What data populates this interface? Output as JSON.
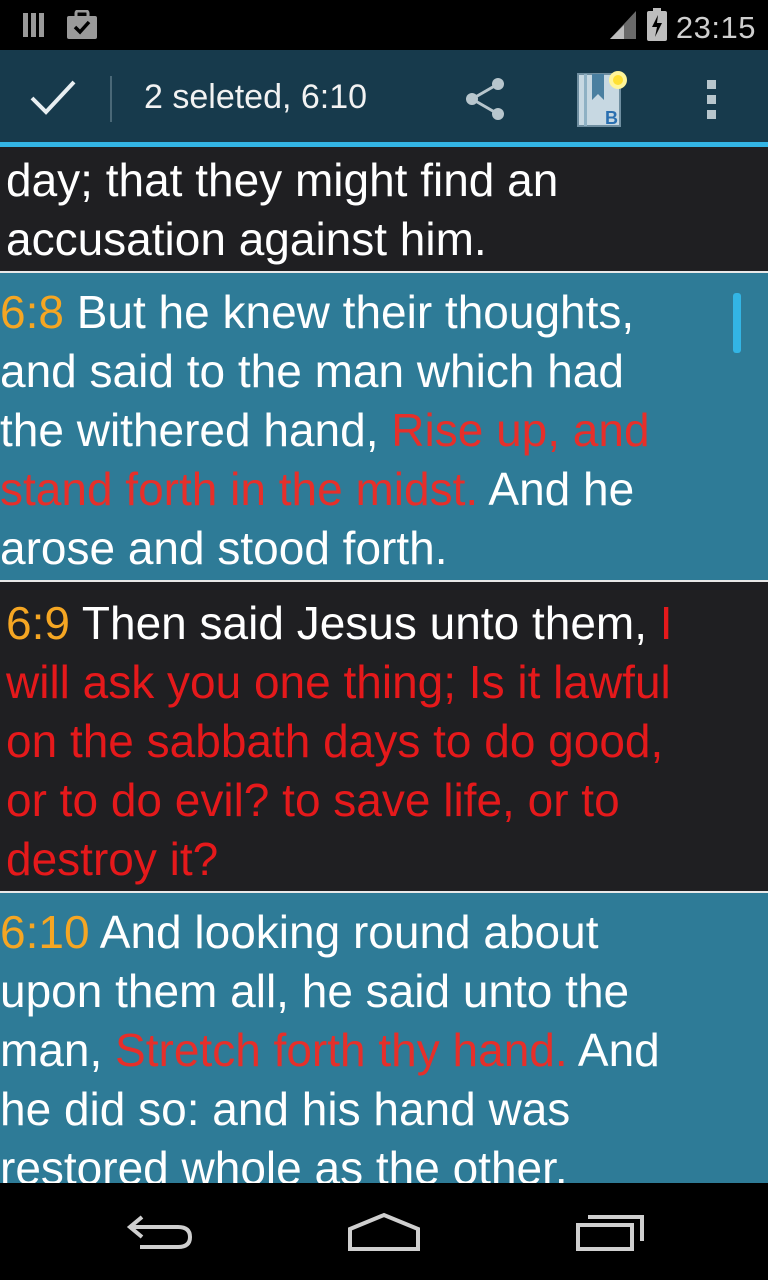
{
  "status_bar": {
    "time": "23:15",
    "icons": [
      "library-icon",
      "clipboard-check-icon",
      "signal-icon",
      "battery-icon"
    ]
  },
  "action_bar": {
    "done_icon": "check-icon",
    "title": "2 seleted, 6:10",
    "actions": [
      "share-icon",
      "bible-bookmark-icon",
      "overflow-menu-icon"
    ],
    "accent_color": "#33b5e5",
    "background_color": "#173a4c"
  },
  "verses": [
    {
      "ref": "",
      "selected": false,
      "lines": [
        [
          {
            "t": "day; that they might find an",
            "c": "w"
          }
        ],
        [
          {
            "t": "accusation against him.",
            "c": "w"
          }
        ]
      ]
    },
    {
      "ref": "6:8",
      "selected": true,
      "lines": [
        [
          {
            "t": "6:8",
            "c": "n"
          },
          {
            "t": " But he knew their thoughts,",
            "c": "w"
          }
        ],
        [
          {
            "t": "and said to the man which had",
            "c": "w"
          }
        ],
        [
          {
            "t": "the withered hand, ",
            "c": "w"
          },
          {
            "t": "Rise up, and",
            "c": "r"
          }
        ],
        [
          {
            "t": "stand forth in the midst.",
            "c": "r"
          },
          {
            "t": " And he",
            "c": "w"
          }
        ],
        [
          {
            "t": "arose and stood forth.",
            "c": "w"
          }
        ]
      ]
    },
    {
      "ref": "6:9",
      "selected": false,
      "lines": [
        [
          {
            "t": "6:9",
            "c": "n"
          },
          {
            "t": " Then said Jesus unto them, ",
            "c": "w"
          },
          {
            "t": "I",
            "c": "r"
          }
        ],
        [
          {
            "t": "will ask you one thing; Is it lawful",
            "c": "r"
          }
        ],
        [
          {
            "t": "on the sabbath days to do good,",
            "c": "r"
          }
        ],
        [
          {
            "t": "or to do evil? to save life, or to",
            "c": "r"
          }
        ],
        [
          {
            "t": "destroy it?",
            "c": "r"
          }
        ]
      ]
    },
    {
      "ref": "6:10",
      "selected": true,
      "lines": [
        [
          {
            "t": "6:10",
            "c": "n"
          },
          {
            "t": " And looking round about",
            "c": "w"
          }
        ],
        [
          {
            "t": "upon them all, he said unto the",
            "c": "w"
          }
        ],
        [
          {
            "t": "man, ",
            "c": "w"
          },
          {
            "t": "Stretch forth thy hand.",
            "c": "r"
          },
          {
            "t": " And",
            "c": "w"
          }
        ],
        [
          {
            "t": "he did so: and his hand was",
            "c": "w"
          }
        ],
        [
          {
            "t": "restored whole as the other.",
            "c": "w"
          }
        ]
      ]
    }
  ],
  "colors": {
    "verse_number": "#f5a623",
    "words_of_jesus": "#e5191b",
    "selected_background": "#2e7b97",
    "normal_background": "#1f1f22"
  },
  "nav_bar": {
    "buttons": [
      "back-icon",
      "home-icon",
      "recent-apps-icon"
    ]
  }
}
